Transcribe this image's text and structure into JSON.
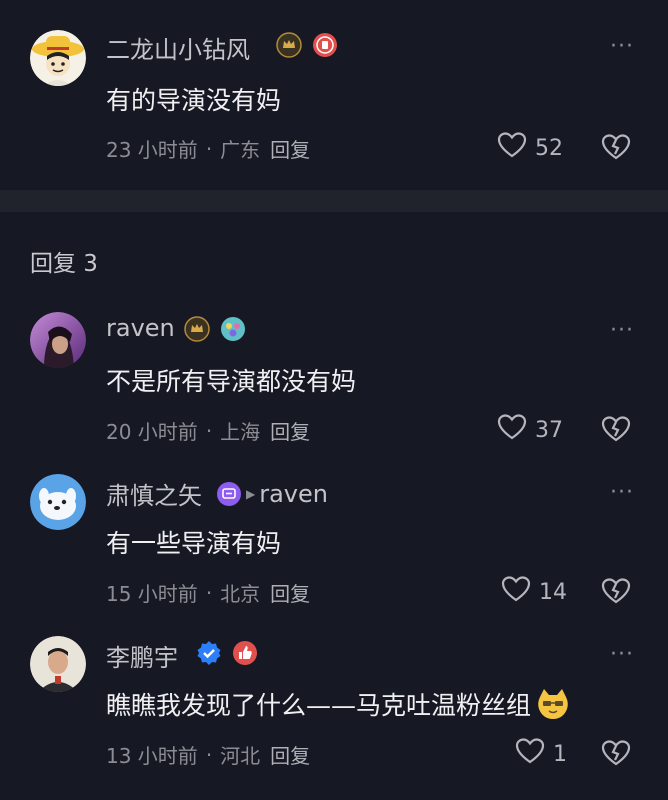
{
  "main_comment": {
    "username": "二龙山小钻风",
    "text": "有的导演没有妈",
    "time": "23 小时前",
    "location": "广东",
    "reply_label": "回复",
    "likes": "52"
  },
  "replies_header": "回复 3",
  "replies": [
    {
      "username": "raven",
      "text": "不是所有导演都没有妈",
      "time": "20 小时前",
      "location": "上海",
      "reply_label": "回复",
      "likes": "37"
    },
    {
      "username": "肃慎之矢",
      "reply_to": "raven",
      "text": "有一些导演有妈",
      "time": "15 小时前",
      "location": "北京",
      "reply_label": "回复",
      "likes": "14"
    },
    {
      "username": "李鹏宇",
      "text": "瞧瞧我发现了什么——马克吐温粉丝组",
      "time": "13 小时前",
      "location": "河北",
      "reply_label": "回复",
      "likes": "1"
    }
  ],
  "separator_dot": "·",
  "more_glyph": "···",
  "colors": {
    "background": "#161823",
    "divider": "#20222c",
    "text": "#f0f0f2",
    "muted": "#8c8d94",
    "crown_badge": "#b38a3a",
    "red_badge": "#e2504e",
    "blue_verified": "#2d7ff9",
    "purple_badge": "#8f5cf0"
  }
}
